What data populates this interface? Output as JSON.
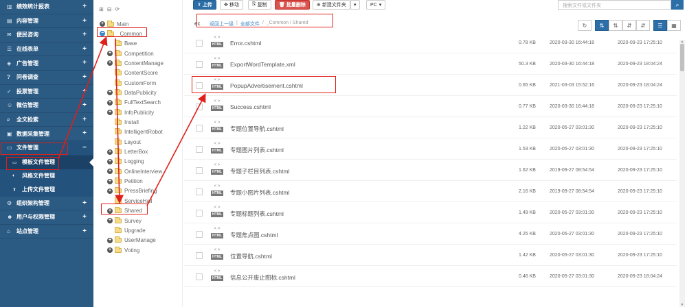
{
  "sidebar": {
    "items": [
      {
        "label": "绩效统计报表",
        "sign": "+"
      },
      {
        "label": "内容管理",
        "sign": "+"
      },
      {
        "label": "便民咨询",
        "sign": "+"
      },
      {
        "label": "在线表单",
        "sign": "+"
      },
      {
        "label": "广告管理",
        "sign": "+"
      },
      {
        "label": "问卷调查",
        "sign": "+"
      },
      {
        "label": "投票管理",
        "sign": "+"
      },
      {
        "label": "微信管理",
        "sign": "+"
      },
      {
        "label": "全文检索",
        "sign": "+"
      },
      {
        "label": "数据采集管理",
        "sign": "+"
      },
      {
        "label": "文件管理",
        "sign": "−"
      }
    ],
    "sub_items": [
      {
        "label": "模板文件管理"
      },
      {
        "label": "风格文件管理"
      },
      {
        "label": "上传文件管理"
      }
    ],
    "items_after": [
      {
        "label": "组织架构管理",
        "sign": "+"
      },
      {
        "label": "用户与权限管理",
        "sign": "+"
      },
      {
        "label": "站点管理",
        "sign": "+"
      }
    ]
  },
  "tree": {
    "nodes": [
      {
        "label": "Main",
        "toggle": "+"
      },
      {
        "label": "_Common",
        "toggle": "−"
      },
      {
        "label": "Base",
        "toggle": ""
      },
      {
        "label": "Competition",
        "toggle": "+"
      },
      {
        "label": "ContentManage",
        "toggle": "+"
      },
      {
        "label": "ContentScore",
        "toggle": ""
      },
      {
        "label": "CustomForm",
        "toggle": ""
      },
      {
        "label": "DataPublicity",
        "toggle": "+"
      },
      {
        "label": "FullTextSearch",
        "toggle": "+"
      },
      {
        "label": "InfoPublicity",
        "toggle": "+"
      },
      {
        "label": "Install",
        "toggle": ""
      },
      {
        "label": "IntelligentRobot",
        "toggle": ""
      },
      {
        "label": "Layout",
        "toggle": ""
      },
      {
        "label": "LetterBox",
        "toggle": "+"
      },
      {
        "label": "Logging",
        "toggle": "+"
      },
      {
        "label": "OnlineInterview",
        "toggle": "+"
      },
      {
        "label": "Petition",
        "toggle": "+"
      },
      {
        "label": "PressBriefing",
        "toggle": "+"
      },
      {
        "label": "ServiceHall",
        "toggle": ""
      },
      {
        "label": "Shared",
        "toggle": "+"
      },
      {
        "label": "Survey",
        "toggle": "+"
      },
      {
        "label": "Upgrade",
        "toggle": ""
      },
      {
        "label": "UserManage",
        "toggle": "+"
      },
      {
        "label": "Voting",
        "toggle": "+"
      }
    ]
  },
  "toolbar": {
    "upload": "上传",
    "move": "移动",
    "copy": "复制",
    "batch_delete": "批量删除",
    "new_folder": "新建文件夹",
    "pc": "PC",
    "search_placeholder": "搜索文件或文件夹"
  },
  "breadcrumb": {
    "prefix": "ec",
    "back": "返回上一级",
    "all": "全部文件",
    "path": "_Common / Shared"
  },
  "files": [
    {
      "name": "Error.cshtml",
      "size": "0.78 KB",
      "created": "2020-03-30 16:44:18",
      "modified": "2020-09-23 17:25:10"
    },
    {
      "name": "ExportWordTemplate.xml",
      "size": "50.3 KB",
      "created": "2020-03-30 16:44:18",
      "modified": "2020-09-23 18:04:24"
    },
    {
      "name": "PopupAdvertisement.cshtml",
      "size": "0.65 KB",
      "created": "2021-03-03 15:52:16",
      "modified": "2020-09-23 18:04:24"
    },
    {
      "name": "Success.cshtml",
      "size": "0.77 KB",
      "created": "2020-03-30 16:44:18",
      "modified": "2020-09-23 17:25:10"
    },
    {
      "name": "专题位置导航.cshtml",
      "size": "1.22 KB",
      "created": "2020-05-27 03:01:30",
      "modified": "2020-09-23 17:25:10"
    },
    {
      "name": "专题图片列表.cshtml",
      "size": "1.53 KB",
      "created": "2020-05-27 03:01:30",
      "modified": "2020-09-23 17:25:10"
    },
    {
      "name": "专题子栏目列表.cshtml",
      "size": "1.62 KB",
      "created": "2019-09-27 08:54:54",
      "modified": "2020-09-23 17:25:10"
    },
    {
      "name": "专题小图片列表.cshtml",
      "size": "2.16 KB",
      "created": "2019-09-27 08:54:54",
      "modified": "2020-09-23 17:25:10"
    },
    {
      "name": "专题标题列表.cshtml",
      "size": "1.49 KB",
      "created": "2020-05-27 03:01:30",
      "modified": "2020-09-23 17:25:10"
    },
    {
      "name": "专题焦点图.cshtml",
      "size": "4.25 KB",
      "created": "2020-05-27 03:01:30",
      "modified": "2020-09-23 17:25:10"
    },
    {
      "name": "位置导航.cshtml",
      "size": "1.42 KB",
      "created": "2020-05-27 03:01:30",
      "modified": "2020-09-23 17:25:10"
    },
    {
      "name": "信息公开废止图标.cshtml",
      "size": "0.46 KB",
      "created": "2020-05-27 03:01:30",
      "modified": "2020-09-23 18:04:24"
    }
  ],
  "file_icon_label": "HTML",
  "file_icon_code": "< >",
  "colors": {
    "sidebar_bg": "#2b5a83",
    "primary": "#2c6ea8",
    "danger": "#d9534f",
    "annotation": "#e0201a"
  }
}
